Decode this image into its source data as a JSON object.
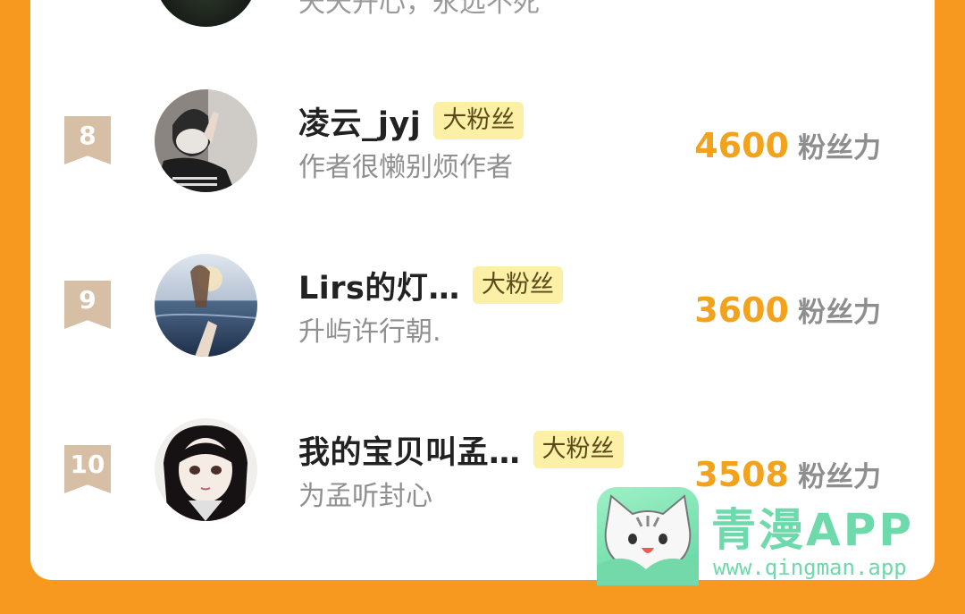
{
  "top_entry": {
    "subtitle": "天天开心，永远不死"
  },
  "entries": [
    {
      "rank": "8",
      "nickname": "凌云_jyj",
      "tag": "大粉丝",
      "subtitle": "作者很懒别烦作者",
      "score": "4600",
      "unit": "粉丝力",
      "avatar": "masked-person-avatar"
    },
    {
      "rank": "9",
      "nickname": "Lirs的灯…",
      "tag": "大粉丝",
      "subtitle": "升屿许行朝.",
      "score": "3600",
      "unit": "粉丝力",
      "avatar": "seaside-hands-avatar"
    },
    {
      "rank": "10",
      "nickname": "我的宝贝叫孟…",
      "tag": "大粉丝",
      "subtitle": "为孟听封心",
      "score": "3508",
      "unit": "粉丝力",
      "avatar": "anime-girl-avatar"
    }
  ],
  "watermark": {
    "title": "青漫APP",
    "url": "www.qingman.app"
  },
  "colors": {
    "background": "#F7981F",
    "score": "#F2A21B",
    "rank_badge": "#D7BFA6",
    "tag_bg": "#FCEFA6",
    "watermark": "#6ED9AA"
  }
}
